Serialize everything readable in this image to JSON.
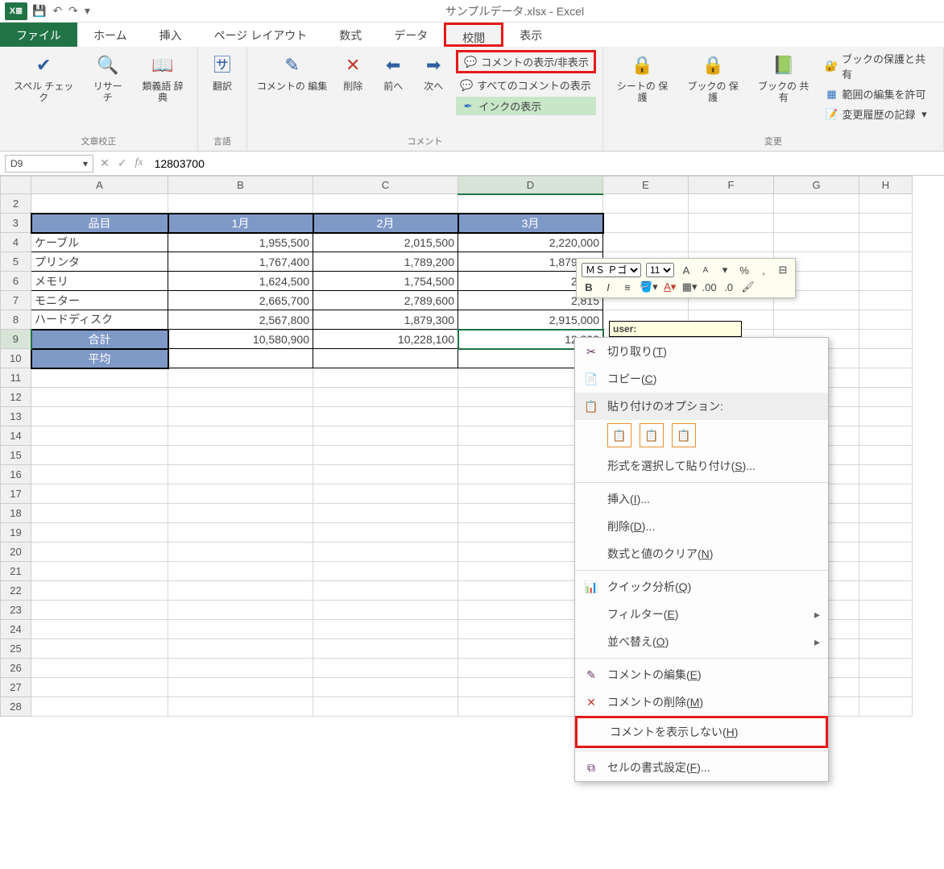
{
  "title": "サンプルデータ.xlsx - Excel",
  "qat": {
    "save": "💾",
    "undo": "↶",
    "redo": "↷",
    "custom": "▾"
  },
  "tabs": {
    "file": "ファイル",
    "home": "ホーム",
    "insert": "挿入",
    "layout": "ページ レイアウト",
    "formula": "数式",
    "data": "データ",
    "review": "校閲",
    "view": "表示"
  },
  "ribbon": {
    "proof": {
      "spell": "スペル\nチェック",
      "research": "リサーチ",
      "thesaurus": "類義語\n辞典",
      "label": "文章校正"
    },
    "lang": {
      "translate": "翻訳",
      "label": "言語"
    },
    "comment": {
      "edit": "コメントの\n編集",
      "delete": "削除",
      "prev": "前へ",
      "next": "次へ",
      "toggle": "コメントの表示/非表示",
      "all": "すべてのコメントの表示",
      "ink": "インクの表示",
      "label": "コメント"
    },
    "protect": {
      "sheet": "シートの\n保護",
      "book": "ブックの\n保護",
      "share": "ブックの\n共有",
      "label": "変更",
      "shareprot": "ブックの保護と共有",
      "range": "範囲の編集を許可",
      "track": "変更履歴の記録"
    }
  },
  "namebox": "D9",
  "formula": "12803700",
  "cols": [
    "A",
    "B",
    "C",
    "D",
    "E",
    "F",
    "G",
    "H"
  ],
  "rows_visible": [
    2,
    3,
    4,
    5,
    6,
    7,
    8,
    9,
    10,
    11,
    12,
    13,
    14,
    15,
    16,
    17,
    18,
    19,
    20,
    21,
    22,
    23,
    24,
    25,
    26,
    27,
    28
  ],
  "table": {
    "head": {
      "a": "品目",
      "b": "1月",
      "c": "2月",
      "d": "3月"
    },
    "rows": [
      {
        "a": "ケーブル",
        "b": "1,955,500",
        "c": "2,015,500",
        "d": "2,220,000"
      },
      {
        "a": "プリンタ",
        "b": "1,767,400",
        "c": "1,789,200",
        "d": "1,879,300"
      },
      {
        "a": "メモリ",
        "b": "1,624,500",
        "c": "1,754,500",
        "d": "2,973"
      },
      {
        "a": "モニター",
        "b": "2,665,700",
        "c": "2,789,600",
        "d": "2,815"
      },
      {
        "a": "ハードディスク",
        "b": "2,567,800",
        "c": "1,879,300",
        "d": "2,915,000"
      }
    ],
    "totals": {
      "a": "合計",
      "b": "10,580,900",
      "c": "10,228,100",
      "d": "12,803"
    },
    "avg": {
      "a": "平均"
    }
  },
  "mini": {
    "font": "ＭＳ Ｐゴ",
    "size": "11"
  },
  "comment_author": "user:",
  "ctx": {
    "cut": "切り取り(T)",
    "copy": "コピー(C)",
    "paste_opt": "貼り付けのオプション:",
    "paste_special": "形式を選択して貼り付け(S)...",
    "insert": "挿入(I)...",
    "delete": "削除(D)...",
    "clear": "数式と値のクリア(N)",
    "quick": "クイック分析(Q)",
    "filter": "フィルター(E)",
    "sort": "並べ替え(O)",
    "editc": "コメントの編集(E)",
    "delc": "コメントの削除(M)",
    "hidec": "コメントを表示しない(H)",
    "format": "セルの書式設定(F)..."
  }
}
